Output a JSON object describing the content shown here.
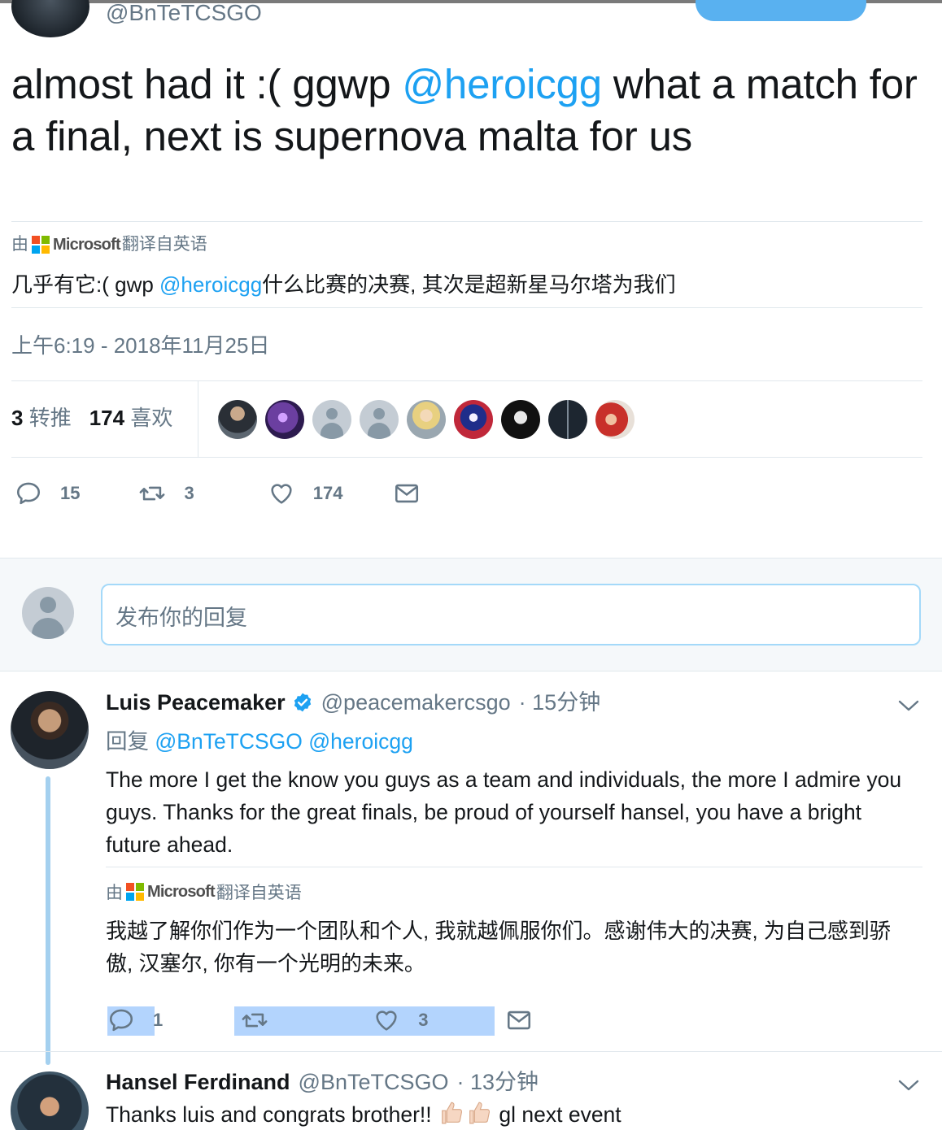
{
  "header": {
    "handle": "@BnTeTCSGO"
  },
  "tweet": {
    "text_before": "almost had it :( ggwp ",
    "mention": "@heroicgg",
    "text_after": " what a match for a final, next is supernova malta for us",
    "translated_by_prefix": "由",
    "translated_by_brand": "Microsoft",
    "translated_by_suffix": "翻译自英语",
    "translation_before": "几乎有它:( gwp ",
    "translation_mention": "@heroicgg",
    "translation_after": "什么比赛的决赛, 其次是超新星马尔塔为我们",
    "timestamp": "上午6:19 - 2018年11月25日",
    "retweets_count": "3",
    "retweets_label": "转推",
    "likes_count": "174",
    "likes_label": "喜欢",
    "likers": [
      "player-avatar",
      "purple-avatar",
      "default-avatar",
      "default-avatar",
      "blonde-avatar",
      "anime-avatar",
      "logo-avatar",
      "dark-avatar",
      "red-avatar"
    ],
    "actions": {
      "replies": "15",
      "retweets": "3",
      "likes": "174"
    }
  },
  "reply_box": {
    "placeholder": "发布你的回复"
  },
  "replies": [
    {
      "name": "Luis Peacemaker",
      "verified": true,
      "handle": "@peacemakercsgo",
      "time": "· 15分钟",
      "reply_to_label": "回复",
      "reply_to": "@BnTeTCSGO @heroicgg",
      "text": "The more I get the know you guys as a team and individuals, the more I admire you guys. Thanks for the great finals, be proud of yourself hansel, you have a bright future ahead.",
      "translated_by_prefix": "由",
      "translated_by_brand": "Microsoft",
      "translated_by_suffix": "翻译自英语",
      "translation": "我越了解你们作为一个团队和个人, 我就越佩服你们。感谢伟大的决赛, 为自己感到骄傲, 汉塞尔, 你有一个光明的未来。",
      "actions": {
        "replies": "1",
        "retweets": "",
        "likes": "3"
      }
    },
    {
      "name": "Hansel Ferdinand",
      "handle": "@BnTeTCSGO",
      "time": "· 13分钟",
      "text_before": "Thanks luis and congrats brother!! ",
      "text_after": " gl next event"
    }
  ],
  "colors": {
    "accent": "#1da1f2",
    "secondary_text": "#657786",
    "border": "#e1e8ed",
    "reply_bg": "#f5f8fa",
    "selection": "#b3d4fd"
  }
}
